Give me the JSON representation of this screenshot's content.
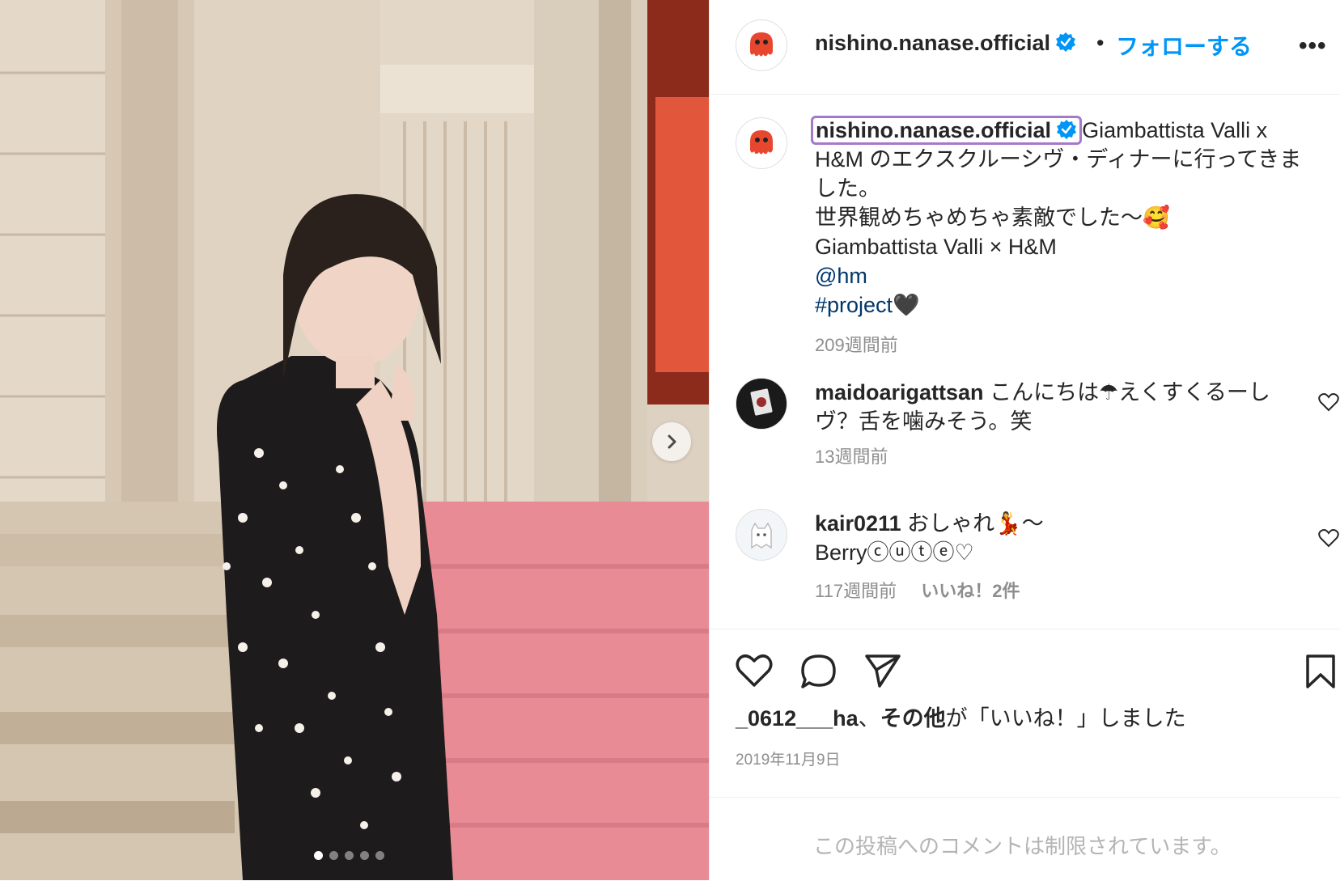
{
  "post": {
    "image_alt": "Portrait photo in front of a stone building with pink carpet steps",
    "carousel_dots": 5,
    "active_dot": 0
  },
  "header": {
    "handle": "nishino.nanase.official",
    "bullet": "•",
    "follow_label": "フォローする",
    "more_label": "•••",
    "verified_icon": "verified-badge-icon"
  },
  "caption": {
    "handle": "nishino.nanase.official",
    "lines": [
      "Giambattista Valli x H&M のエクスクルーシヴ・ディナーに行ってきました。",
      "世界観めちゃめちゃ素敵でした〜🥰",
      "Giambattista Valli × H&M"
    ],
    "mention": "@hm",
    "hashtag": "#project",
    "hashtag_emoji": "🖤",
    "time": "209週間前"
  },
  "comments": [
    {
      "username": "maidoarigattsan",
      "text": "こんにちは☂えくすくるーしヴ？舌を噛みそう。笑",
      "time": "13週間前",
      "likes": ""
    },
    {
      "username": "kair0211",
      "text": "おしゃれ💃〜",
      "text2": "Berryⓒⓤⓣⓔ♡",
      "time": "117週間前",
      "likes": "いいね！2件"
    }
  ],
  "footer": {
    "liked_by": "_0612___ha",
    "liked_sep": "、",
    "liked_others": "その他",
    "liked_suffix": "が「いいね！」しました",
    "date": "2019年11月9日",
    "restricted": "この投稿へのコメントは制限されています。"
  },
  "colors": {
    "accent": "#0095f6",
    "link": "#00376b",
    "muted": "#8e8e8e",
    "highlight_border": "#a678c8",
    "avatar_octopus": "#e8472f"
  }
}
